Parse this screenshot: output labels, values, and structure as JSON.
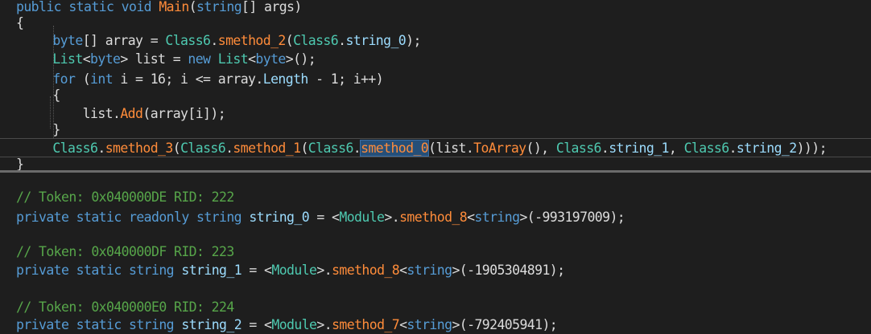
{
  "code_top": [
    {
      "id": "l1",
      "parts": [
        [
          "kw",
          "public static void "
        ],
        [
          "cl",
          "Main"
        ],
        [
          "pl",
          "("
        ],
        [
          "kw",
          "string"
        ],
        [
          "pl",
          "[] args)"
        ]
      ]
    },
    {
      "id": "l2",
      "parts": [
        [
          "pl",
          "{"
        ]
      ]
    },
    {
      "id": "l3",
      "parts": [
        [
          "pl",
          "    "
        ],
        [
          "kw",
          "byte"
        ],
        [
          "pl",
          "[] array = "
        ],
        [
          "ty",
          "Class6"
        ],
        [
          "pl",
          "."
        ],
        [
          "cl",
          "smethod_2"
        ],
        [
          "pl",
          "("
        ],
        [
          "ty",
          "Class6"
        ],
        [
          "pl",
          "."
        ],
        [
          "fld",
          "string_0"
        ],
        [
          "pl",
          ");"
        ]
      ]
    },
    {
      "id": "l4",
      "parts": [
        [
          "pl",
          "    "
        ],
        [
          "ty",
          "List"
        ],
        [
          "pl",
          "<"
        ],
        [
          "kw",
          "byte"
        ],
        [
          "pl",
          "> list = "
        ],
        [
          "kw",
          "new "
        ],
        [
          "ty",
          "List"
        ],
        [
          "pl",
          "<"
        ],
        [
          "kw",
          "byte"
        ],
        [
          "pl",
          ">();"
        ]
      ]
    },
    {
      "id": "l5",
      "parts": [
        [
          "pl",
          "    "
        ],
        [
          "kw",
          "for"
        ],
        [
          "pl",
          " ("
        ],
        [
          "kw",
          "int"
        ],
        [
          "pl",
          " i = 16; i <= array."
        ],
        [
          "fld",
          "Length"
        ],
        [
          "pl",
          " - 1; i++)"
        ]
      ]
    },
    {
      "id": "l6",
      "parts": [
        [
          "pl",
          "    {"
        ]
      ]
    },
    {
      "id": "l7",
      "parts": [
        [
          "pl",
          "        list."
        ],
        [
          "cl",
          "Add"
        ],
        [
          "pl",
          "(array[i]);"
        ]
      ]
    },
    {
      "id": "l8",
      "parts": [
        [
          "pl",
          "    }"
        ]
      ]
    },
    {
      "id": "l9",
      "parts": [
        [
          "pl",
          "    "
        ],
        [
          "ty",
          "Class6"
        ],
        [
          "pl",
          "."
        ],
        [
          "cl",
          "smethod_3"
        ],
        [
          "pl",
          "("
        ],
        [
          "ty",
          "Class6"
        ],
        [
          "pl",
          "."
        ],
        [
          "cl",
          "smethod_1"
        ],
        [
          "pl",
          "("
        ],
        [
          "ty",
          "Class6"
        ],
        [
          "pl",
          "."
        ],
        [
          "sel",
          "smethod_0"
        ],
        [
          "pl",
          "(list."
        ],
        [
          "cl",
          "ToArray"
        ],
        [
          "pl",
          "(), "
        ],
        [
          "ty",
          "Class6"
        ],
        [
          "pl",
          "."
        ],
        [
          "fld",
          "string_1"
        ],
        [
          "pl",
          ", "
        ],
        [
          "ty",
          "Class6"
        ],
        [
          "pl",
          "."
        ],
        [
          "fld",
          "string_2"
        ],
        [
          "pl",
          ")));"
        ]
      ]
    },
    {
      "id": "l10",
      "parts": [
        [
          "pl",
          "}"
        ]
      ]
    }
  ],
  "code_bottom": [
    {
      "id": "b1",
      "parts": [
        [
          "cm",
          "// Token: 0x040000DE RID: 222"
        ]
      ]
    },
    {
      "id": "b2",
      "parts": [
        [
          "kw",
          "private static readonly string "
        ],
        [
          "fld",
          "string_0"
        ],
        [
          "pl",
          " = <"
        ],
        [
          "ty",
          "Module"
        ],
        [
          "pl",
          ">."
        ],
        [
          "cl",
          "smethod_8"
        ],
        [
          "pl",
          "<"
        ],
        [
          "kw",
          "string"
        ],
        [
          "pl",
          ">(-993197009);"
        ]
      ]
    },
    {
      "id": "b3",
      "parts": [
        [
          "cm",
          "// Token: 0x040000DF RID: 223"
        ]
      ]
    },
    {
      "id": "b4",
      "parts": [
        [
          "kw",
          "private static string "
        ],
        [
          "fld",
          "string_1"
        ],
        [
          "pl",
          " = <"
        ],
        [
          "ty",
          "Module"
        ],
        [
          "pl",
          ">."
        ],
        [
          "cl",
          "smethod_8"
        ],
        [
          "pl",
          "<"
        ],
        [
          "kw",
          "string"
        ],
        [
          "pl",
          ">(-1905304891);"
        ]
      ]
    },
    {
      "id": "b5",
      "parts": [
        [
          "cm",
          "// Token: 0x040000E0 RID: 224"
        ]
      ]
    },
    {
      "id": "b6",
      "parts": [
        [
          "kw",
          "private static string "
        ],
        [
          "fld",
          "string_2"
        ],
        [
          "pl",
          " = <"
        ],
        [
          "ty",
          "Module"
        ],
        [
          "pl",
          ">."
        ],
        [
          "cl",
          "smethod_7"
        ],
        [
          "pl",
          "<"
        ],
        [
          "kw",
          "string"
        ],
        [
          "pl",
          ">(-792405941);"
        ]
      ]
    }
  ]
}
